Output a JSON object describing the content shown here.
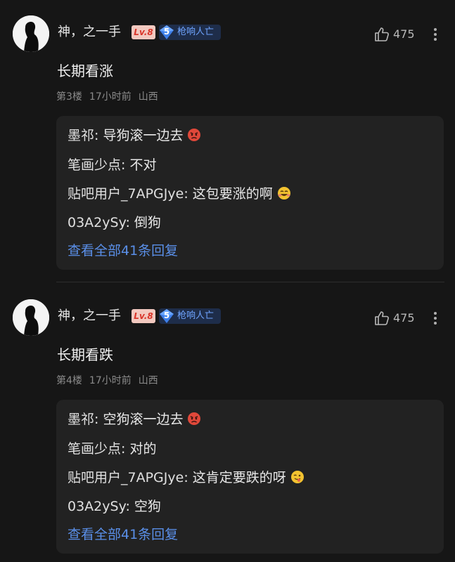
{
  "posts": [
    {
      "username": "神，之一手",
      "level": "Lv.8",
      "tier_number": "5",
      "tier_name": "枪响人亡",
      "likes": "475",
      "content": "长期看涨",
      "floor": "第3楼",
      "time": "17小时前",
      "location": "山西",
      "replies": [
        {
          "name": "墨祁",
          "sep": ": ",
          "text": "导狗滚一边去",
          "emoji": "angry-face-emoji"
        },
        {
          "name": "笔画少点",
          "sep": ": ",
          "text": "不对",
          "emoji": ""
        },
        {
          "name": "贴吧用户_7APGJye",
          "sep": ": ",
          "text": "这包要涨的啊",
          "emoji": "grin-face-emoji"
        },
        {
          "name": "03A2ySy",
          "sep": ": ",
          "text": "倒狗",
          "emoji": ""
        }
      ],
      "view_all": "查看全部41条回复"
    },
    {
      "username": "神，之一手",
      "level": "Lv.8",
      "tier_number": "5",
      "tier_name": "枪响人亡",
      "likes": "475",
      "content": "长期看跌",
      "floor": "第4楼",
      "time": "17小时前",
      "location": "山西",
      "replies": [
        {
          "name": "墨祁",
          "sep": ": ",
          "text": "空狗滚一边去",
          "emoji": "angry-face-emoji"
        },
        {
          "name": "笔画少点",
          "sep": ": ",
          "text": "对的",
          "emoji": ""
        },
        {
          "name": "贴吧用户_7APGJye",
          "sep": ": ",
          "text": "这肯定要跌的呀",
          "emoji": "tongue-face-emoji"
        },
        {
          "name": "03A2ySy",
          "sep": ": ",
          "text": "空狗",
          "emoji": ""
        }
      ],
      "view_all": "查看全部41条回复"
    }
  ],
  "colors": {
    "background": "#161616",
    "reply_box": "#222222",
    "link": "#5a8fe8",
    "level_badge_bg": "#f3c9c0",
    "level_badge_text": "#d9362b",
    "tier_text": "#6fa4ff"
  }
}
